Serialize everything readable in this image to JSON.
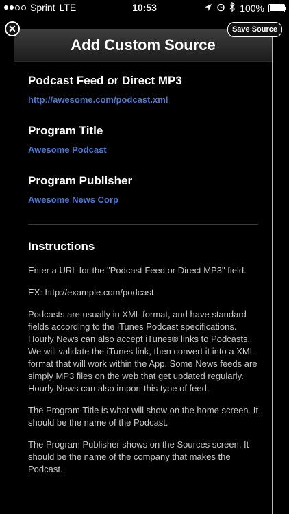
{
  "status_bar": {
    "carrier": "Sprint",
    "network": "LTE",
    "time": "10:53",
    "battery": "100%",
    "battery_level": 1.0
  },
  "header": {
    "title": "Add Custom Source",
    "close_icon": "close-icon",
    "save_label": "Save Source"
  },
  "fields": [
    {
      "label": "Podcast Feed or Direct MP3",
      "value": "http://awesome.com/podcast.xml"
    },
    {
      "label": "Program Title",
      "value": "Awesome Podcast"
    },
    {
      "label": "Program Publisher",
      "value": "Awesome News Corp"
    }
  ],
  "instructions": {
    "title": "Instructions",
    "paragraphs": [
      "Enter a URL for the \"Podcast Feed or Direct MP3\" field.",
      "EX: http://example.com/podcast",
      "Podcasts are usually in XML format, and have standard fields according to the iTunes Podcast specifications. Hourly News can also accept iTunes® links to Podcasts. We will validate the iTunes link, then convert it into a XML format that will work within the App. Some News feeds are simply MP3 files on the web that get updated regularly. Hourly News can also import this type of feed.",
      "The Program Title is what will show on the home screen. It should be the name of the Podcast.",
      "The Program Publisher shows on the Sources screen. It should be the name of the company that makes the Podcast."
    ]
  }
}
